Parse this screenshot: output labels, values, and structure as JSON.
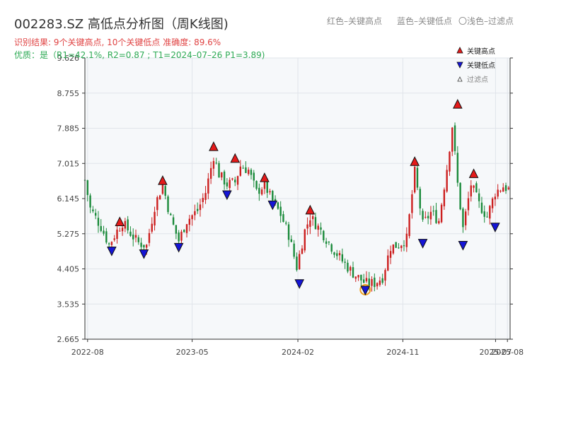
{
  "header": {
    "title": "002283.SZ 高低点分析图（周K线图)",
    "legend_red": "红色–关键高点",
    "legend_blue": "蓝色–关键低点",
    "legend_light": "〇浅色–过滤点",
    "result_line": "识别结果: 9个关键高点, 10个关键低点   准确度: 89.6%",
    "quality_line": "优质：是（R1=42.1%, R2=0.87 ; T1=2024–07–26 P1=3.89)"
  },
  "colors": {
    "up": "#cc1f1f",
    "down": "#1a8a3a",
    "high_marker": "#e41a1a",
    "low_marker": "#1515d6",
    "filtered_circle": "#f0a020",
    "plot_bg": "#f6f8fa",
    "grid": "#e0e4ea"
  },
  "chart_data": {
    "type": "candlestick",
    "x_axis": {
      "type": "time",
      "ticks": [
        "2022-08",
        "2023-05",
        "2024-02",
        "2024-11",
        "2025-07",
        "2025-08"
      ],
      "range": [
        "2022-07-25",
        "2025-08-08"
      ]
    },
    "y_axis": {
      "ticks": [
        2.665,
        3.535,
        4.405,
        5.275,
        6.145,
        7.015,
        7.885,
        8.755,
        9.626
      ],
      "ylim": [
        2.665,
        9.626
      ]
    },
    "grid": true,
    "legend": {
      "position": "top-right",
      "items": [
        "关键高点",
        "关键低点",
        "过滤点"
      ]
    },
    "close_path": [
      [
        "2022-07-25",
        6.6
      ],
      [
        "2022-08-08",
        5.9
      ],
      [
        "2022-09-05",
        5.45
      ],
      [
        "2022-09-26",
        5.0
      ],
      [
        "2022-10-17",
        5.35
      ],
      [
        "2022-10-31",
        5.55
      ],
      [
        "2022-11-28",
        5.2
      ],
      [
        "2022-12-12",
        5.05
      ],
      [
        "2023-01-02",
        4.98
      ],
      [
        "2023-01-23",
        5.95
      ],
      [
        "2023-02-13",
        6.5
      ],
      [
        "2023-03-06",
        5.65
      ],
      [
        "2023-03-27",
        5.1
      ],
      [
        "2023-04-17",
        5.6
      ],
      [
        "2023-05-15",
        5.85
      ],
      [
        "2023-06-05",
        6.3
      ],
      [
        "2023-06-26",
        7.2
      ],
      [
        "2023-07-10",
        6.75
      ],
      [
        "2023-07-31",
        6.5
      ],
      [
        "2023-08-21",
        6.55
      ],
      [
        "2023-09-04",
        6.95
      ],
      [
        "2023-09-25",
        6.85
      ],
      [
        "2023-10-16",
        6.3
      ],
      [
        "2023-11-06",
        6.5
      ],
      [
        "2023-11-20",
        6.2
      ],
      [
        "2023-12-18",
        5.75
      ],
      [
        "2024-01-08",
        5.25
      ],
      [
        "2024-01-29",
        4.45
      ],
      [
        "2024-02-19",
        5.35
      ],
      [
        "2024-03-04",
        5.7
      ],
      [
        "2024-04-01",
        5.35
      ],
      [
        "2024-04-29",
        4.95
      ],
      [
        "2024-05-27",
        4.6
      ],
      [
        "2024-06-24",
        4.3
      ],
      [
        "2024-07-26",
        4.05
      ],
      [
        "2024-08-19",
        4.05
      ],
      [
        "2024-09-09",
        4.2
      ],
      [
        "2024-09-30",
        4.95
      ],
      [
        "2024-10-21",
        5.0
      ],
      [
        "2024-11-11",
        5.15
      ],
      [
        "2024-12-02",
        6.8
      ],
      [
        "2024-12-23",
        5.5
      ],
      [
        "2025-01-13",
        5.8
      ],
      [
        "2025-02-03",
        5.6
      ],
      [
        "2025-02-24",
        6.9
      ],
      [
        "2025-03-10",
        7.95
      ],
      [
        "2025-03-24",
        6.5
      ],
      [
        "2025-04-07",
        5.4
      ],
      [
        "2025-04-28",
        6.5
      ],
      [
        "2025-05-19",
        6.0
      ],
      [
        "2025-06-09",
        5.7
      ],
      [
        "2025-06-30",
        6.3
      ],
      [
        "2025-07-21",
        6.45
      ],
      [
        "2025-08-08",
        6.35
      ]
    ],
    "key_highs": [
      {
        "date": "2022-10-24",
        "price": 5.56
      },
      {
        "date": "2023-02-13",
        "price": 6.58
      },
      {
        "date": "2023-06-26",
        "price": 7.42
      },
      {
        "date": "2023-08-21",
        "price": 7.13
      },
      {
        "date": "2023-11-06",
        "price": 6.65
      },
      {
        "date": "2024-03-04",
        "price": 5.85
      },
      {
        "date": "2024-12-02",
        "price": 7.05
      },
      {
        "date": "2025-03-24",
        "price": 8.47
      },
      {
        "date": "2025-05-05",
        "price": 6.75
      }
    ],
    "key_lows": [
      {
        "date": "2022-10-03",
        "price": 4.86
      },
      {
        "date": "2022-12-26",
        "price": 4.79
      },
      {
        "date": "2023-03-27",
        "price": 4.95
      },
      {
        "date": "2023-07-31",
        "price": 6.25
      },
      {
        "date": "2023-11-27",
        "price": 6.0
      },
      {
        "date": "2024-02-05",
        "price": 4.05
      },
      {
        "date": "2024-07-26",
        "price": 3.89
      },
      {
        "date": "2024-12-23",
        "price": 5.05
      },
      {
        "date": "2025-04-07",
        "price": 5.0
      },
      {
        "date": "2025-06-30",
        "price": 5.45
      }
    ],
    "filtered_points": [
      {
        "date": "2024-07-26",
        "price": 3.89
      }
    ]
  }
}
